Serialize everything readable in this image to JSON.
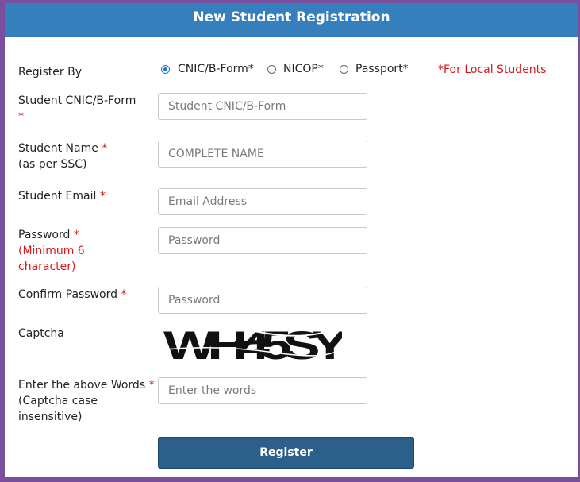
{
  "header": {
    "title": "New Student Registration"
  },
  "register_by": {
    "label": "Register By",
    "options": [
      {
        "label": "CNIC/B-Form*",
        "selected": true
      },
      {
        "label": "NICOP*",
        "selected": false
      },
      {
        "label": "Passport*",
        "selected": false
      }
    ],
    "note": "*For Local Students"
  },
  "cnic": {
    "label": "Student CNIC/B-Form",
    "required": "*",
    "placeholder": "Student CNIC/B-Form"
  },
  "name": {
    "label": "Student Name",
    "required": "*",
    "sub": "(as per SSC)",
    "placeholder": "COMPLETE NAME"
  },
  "email": {
    "label": "Student Email",
    "required": "*",
    "placeholder": "Email Address"
  },
  "password": {
    "label": "Password",
    "required": "*",
    "note_line1": "(Minimum 6",
    "note_line2": "character)",
    "placeholder": "Password"
  },
  "confirm": {
    "label": "Confirm Password",
    "required": "*",
    "placeholder": "Password"
  },
  "captcha": {
    "label": "Captcha",
    "text": "WH45SY"
  },
  "words": {
    "label": "Enter the above Words",
    "required": "*",
    "sub1": "(Captcha case",
    "sub2": "insensitive)",
    "placeholder": "Enter the words"
  },
  "submit": {
    "label": "Register"
  },
  "colors": {
    "header": "#357fbd",
    "button": "#2d5f8b",
    "required": "#d8181c",
    "frame": "#7a4f9e"
  }
}
